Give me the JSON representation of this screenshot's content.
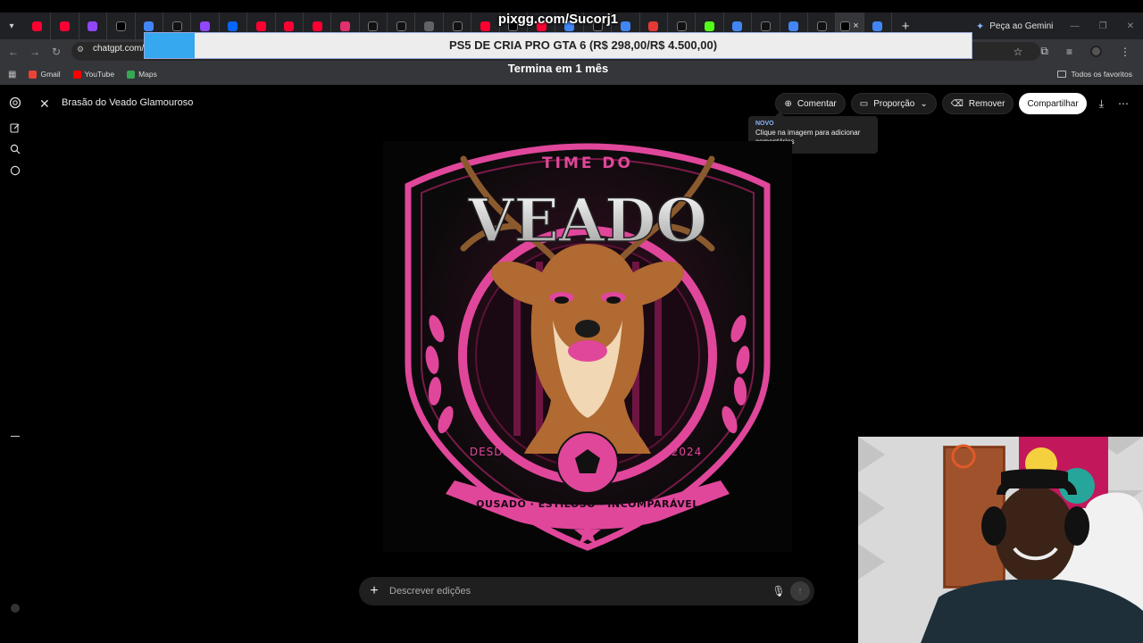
{
  "overlay": {
    "top_url": "pixgg.com/Sucorj1",
    "banner_text": "PS5 DE CRIA PRO GTA 6 (R$ 298,00/R$ 4.500,00)",
    "banner_subtext": "Termina em 1 mês"
  },
  "browser": {
    "url_text": "chatgpt.com/",
    "gemini_label": "Peça ao Gemini",
    "bookmarks": [
      {
        "label": "Gmail",
        "color": "#ea4335"
      },
      {
        "label": "YouTube",
        "color": "#ff0000"
      },
      {
        "label": "Maps",
        "color": "#34a853"
      }
    ],
    "favorites_label": "Todos os favoritos",
    "tabs": [
      {
        "icon": "youtube-icon",
        "color": "#ff0033"
      },
      {
        "icon": "youtube-icon",
        "color": "#ff0033"
      },
      {
        "icon": "twitch-icon",
        "color": "#9146ff"
      },
      {
        "icon": "x-icon",
        "color": "#000000"
      },
      {
        "icon": "google-icon",
        "color": "#4285f4"
      },
      {
        "icon": "tiktok-icon",
        "color": "#111111"
      },
      {
        "icon": "twitch-icon",
        "color": "#9146ff"
      },
      {
        "icon": "meta-icon",
        "color": "#0866ff"
      },
      {
        "icon": "youtube-icon",
        "color": "#ff0033"
      },
      {
        "icon": "youtube-icon",
        "color": "#ff0033"
      },
      {
        "icon": "youtube-icon",
        "color": "#ff0033"
      },
      {
        "icon": "instagram-icon",
        "color": "#e1306c"
      },
      {
        "icon": "tiktok-icon",
        "color": "#111111"
      },
      {
        "icon": "tiktok-icon",
        "color": "#111111"
      },
      {
        "icon": "media-icon",
        "color": "#5f6368"
      },
      {
        "icon": "tiktok-icon",
        "color": "#111111"
      },
      {
        "icon": "youtube-icon",
        "color": "#ff0033"
      },
      {
        "icon": "x-icon",
        "color": "#000000"
      },
      {
        "icon": "youtube-icon",
        "color": "#ff0033"
      },
      {
        "icon": "google-icon",
        "color": "#4285f4"
      },
      {
        "icon": "tiktok-icon",
        "color": "#111111"
      },
      {
        "icon": "google-icon",
        "color": "#4285f4"
      },
      {
        "icon": "custom-red-icon",
        "color": "#e53935"
      },
      {
        "icon": "tiktok-icon",
        "color": "#111111"
      },
      {
        "icon": "kick-icon",
        "color": "#53fc18"
      },
      {
        "icon": "google-icon",
        "color": "#4285f4"
      },
      {
        "icon": "tiktok-icon",
        "color": "#111111"
      },
      {
        "icon": "google-icon",
        "color": "#4285f4"
      },
      {
        "icon": "tiktok-icon",
        "color": "#111111"
      },
      {
        "icon": "chatgpt-icon",
        "color": "#000000",
        "active": true
      },
      {
        "icon": "google-icon",
        "color": "#4285f4"
      }
    ]
  },
  "app": {
    "title": "Brasão do Veado Glamouroso",
    "toolbar": {
      "comment_label": "Comentar",
      "proportion_label": "Proporção",
      "remove_label": "Remover",
      "share_label": "Compartilhar"
    },
    "tooltip": {
      "badge": "NOVO",
      "text": "Clique na imagem para adicionar comentários"
    },
    "composer": {
      "placeholder": "Descrever edições"
    },
    "image": {
      "top_text": "TIME DO",
      "main_text": "VEADO",
      "left_text": "DESDE",
      "right_text": "2024",
      "ribbon_text": "OUSADO · ESTILOSO · INCOMPARÁVEL",
      "accent_color": "#e0479b"
    }
  }
}
